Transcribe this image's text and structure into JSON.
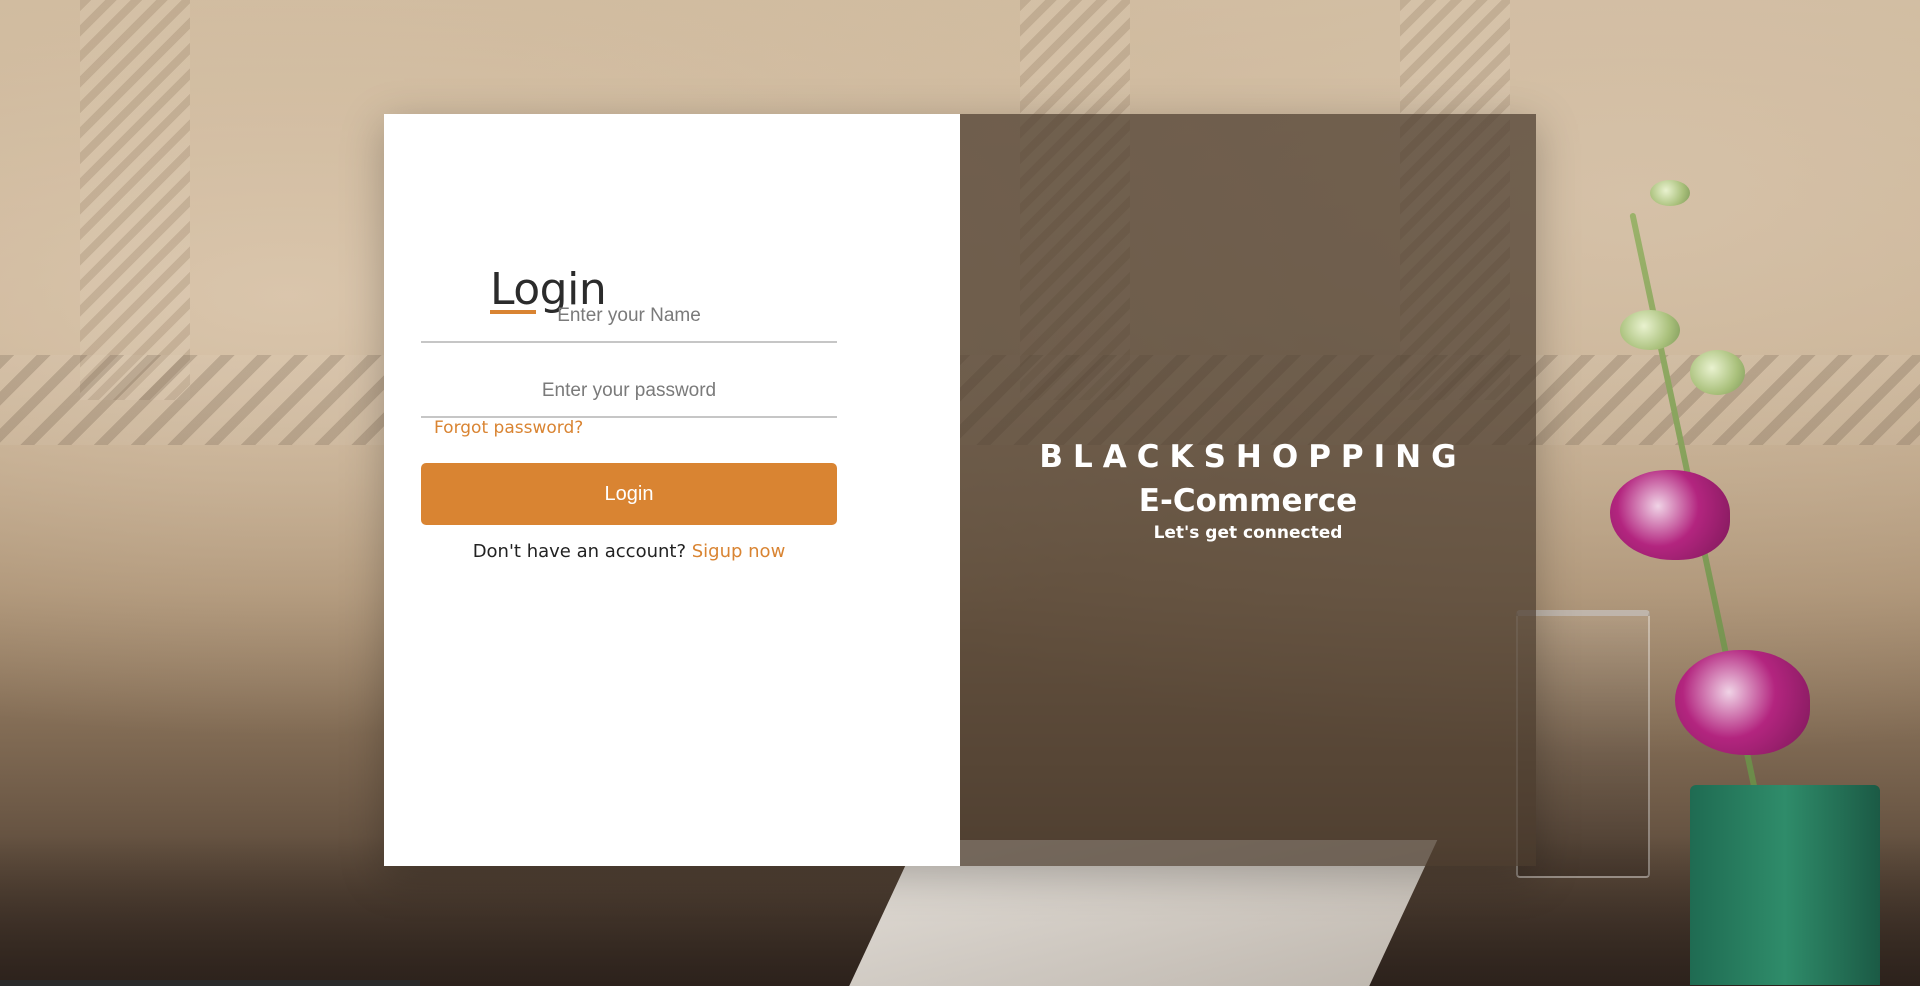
{
  "login": {
    "title": "Login",
    "name_placeholder": "Enter your Name",
    "password_placeholder": "Enter your password",
    "forgot_label": "Forgot password?",
    "button_label": "Login",
    "signup_prompt": "Don't have an account?",
    "signup_link": "Sigup now"
  },
  "brand": {
    "name": "BLACKSHOPPING",
    "subtitle": "E-Commerce",
    "tagline": "Let's get connected"
  },
  "colors": {
    "accent": "#d98432",
    "panel_overlay": "#4a3a2d"
  }
}
